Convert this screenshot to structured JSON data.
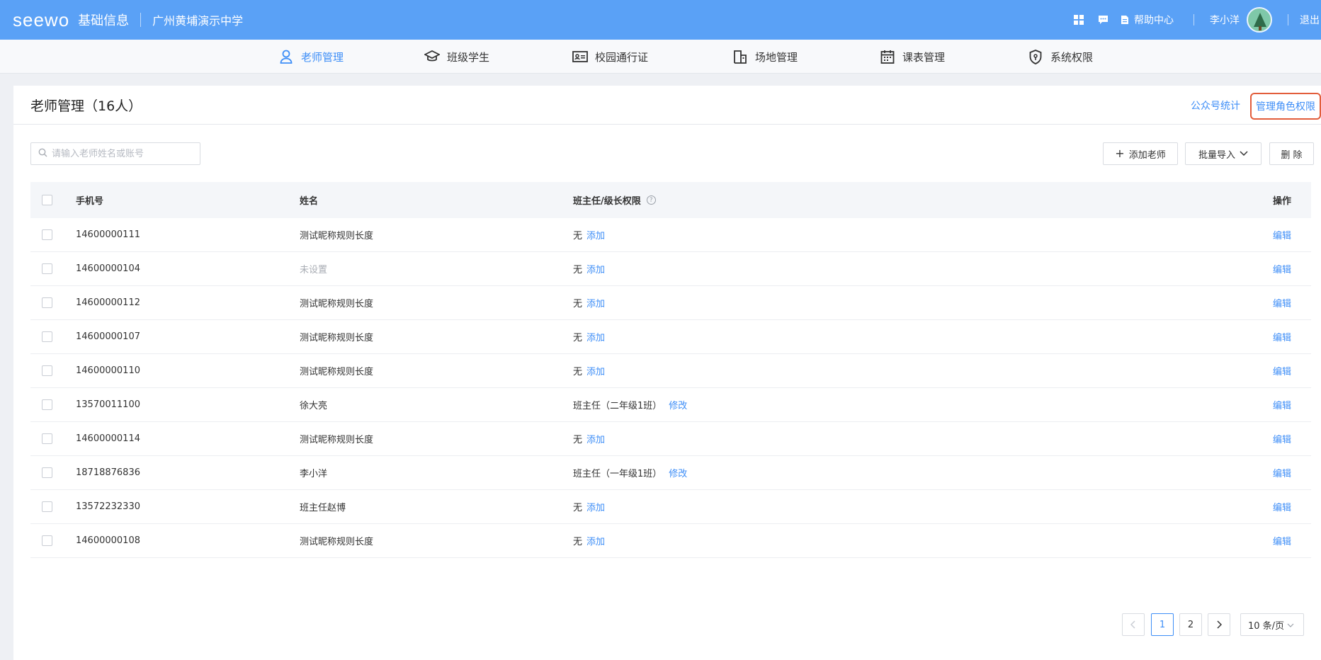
{
  "header": {
    "logo": "seewo",
    "app_title": "基础信息",
    "school": "广州黄埔演示中学",
    "help_label": "帮助中心",
    "username": "李小洋",
    "logout": "退出",
    "icons": [
      "apps-icon",
      "message-icon",
      "document-icon"
    ]
  },
  "nav": {
    "items": [
      {
        "label": "老师管理",
        "icon": "user-icon",
        "active": true
      },
      {
        "label": "班级学生",
        "icon": "graduation-cap-icon",
        "active": false
      },
      {
        "label": "校园通行证",
        "icon": "id-card-icon",
        "active": false
      },
      {
        "label": "场地管理",
        "icon": "building-icon",
        "active": false
      },
      {
        "label": "课表管理",
        "icon": "calendar-icon",
        "active": false
      },
      {
        "label": "系统权限",
        "icon": "shield-icon",
        "active": false
      }
    ]
  },
  "page": {
    "title": "老师管理（16人）",
    "link_stats": "公众号统计",
    "link_roles": "管理角色权限"
  },
  "toolbar": {
    "search_placeholder": "请输入老师姓名或账号",
    "add_label": "添加老师",
    "import_label": "批量导入",
    "delete_label": "删 除"
  },
  "table": {
    "headers": {
      "phone": "手机号",
      "name": "姓名",
      "role": "班主任/级长权限",
      "op": "操作"
    },
    "rows": [
      {
        "phone": "14600000111",
        "name": "测试昵称规则长度",
        "name_muted": false,
        "role": "无",
        "action": "添加",
        "op": "编辑"
      },
      {
        "phone": "14600000104",
        "name": "未设置",
        "name_muted": true,
        "role": "无",
        "action": "添加",
        "op": "编辑"
      },
      {
        "phone": "14600000112",
        "name": "测试昵称规则长度",
        "name_muted": false,
        "role": "无",
        "action": "添加",
        "op": "编辑"
      },
      {
        "phone": "14600000107",
        "name": "测试昵称规则长度",
        "name_muted": false,
        "role": "无",
        "action": "添加",
        "op": "编辑"
      },
      {
        "phone": "14600000110",
        "name": "测试昵称规则长度",
        "name_muted": false,
        "role": "无",
        "action": "添加",
        "op": "编辑"
      },
      {
        "phone": "13570011100",
        "name": "徐大亮",
        "name_muted": false,
        "role": "班主任（二年级1班）",
        "action": "修改",
        "op": "编辑"
      },
      {
        "phone": "14600000114",
        "name": "测试昵称规则长度",
        "name_muted": false,
        "role": "无",
        "action": "添加",
        "op": "编辑"
      },
      {
        "phone": "18718876836",
        "name": "李小洋",
        "name_muted": false,
        "role": "班主任（一年级1班）",
        "action": "修改",
        "op": "编辑"
      },
      {
        "phone": "13572232330",
        "name": "班主任赵博",
        "name_muted": false,
        "role": "无",
        "action": "添加",
        "op": "编辑"
      },
      {
        "phone": "14600000108",
        "name": "测试昵称规则长度",
        "name_muted": false,
        "role": "无",
        "action": "添加",
        "op": "编辑"
      }
    ]
  },
  "pagination": {
    "prev": "<",
    "pages": [
      "1",
      "2"
    ],
    "current": "1",
    "next": ">",
    "page_size": "10 条/页"
  },
  "colors": {
    "header_bg": "#5aa1f6",
    "accent": "#3e8ef7",
    "highlight_border": "#e25d3b"
  }
}
